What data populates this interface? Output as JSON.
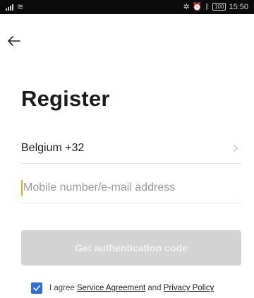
{
  "status_bar": {
    "time": "15:50",
    "battery": "100"
  },
  "header": {
    "title": "Register"
  },
  "form": {
    "country": "Belgium +32",
    "phone_placeholder": "Mobile number/e-mail address",
    "phone_value": ""
  },
  "actions": {
    "auth_button_label": "Get authentication code",
    "auth_button_enabled": false
  },
  "agreement": {
    "checked": true,
    "prefix": "I agree",
    "service_link": "Service Agreement",
    "conjunction": "and",
    "privacy_link": "Privacy Policy"
  },
  "icons": {
    "back": "arrow-left-icon",
    "chevron": "chevron-right-icon",
    "checkbox": "check-icon"
  },
  "colors": {
    "accent": "#2f6fd1",
    "button_disabled": "#d3d3d3",
    "caret": "#f0a020"
  }
}
